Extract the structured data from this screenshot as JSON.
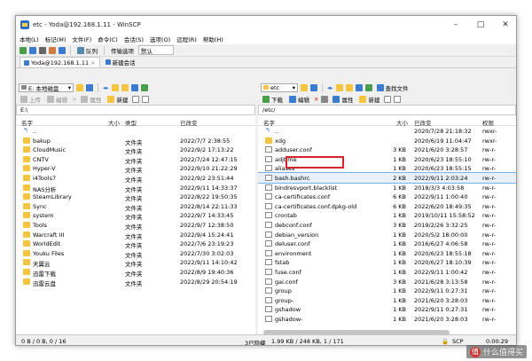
{
  "window": {
    "title": "etc - Yoda@192.168.1.11 - WinSCP"
  },
  "menu": [
    "本地(L)",
    "标记(M)",
    "文件(F)",
    "命令(C)",
    "会话(S)",
    "选项(O)",
    "远程(R)",
    "帮助(H)"
  ],
  "toolbar": {
    "sync_label": "队列",
    "transfer_label": "传输选项",
    "transfer_value": "默认"
  },
  "tabs": [
    "Yoda@192.168.1.11",
    "新建会话"
  ],
  "left": {
    "drive": "E: 本地磁盘",
    "upload": "上传",
    "edit": "编辑",
    "props": "属性",
    "new": "新建",
    "path": "E:\\",
    "headers": {
      "name": "名字",
      "size": "大小",
      "type": "类型",
      "modified": "已改变"
    },
    "rows": [
      {
        "name": "..",
        "size": "",
        "type": "",
        "modified": "",
        "kind": "up"
      },
      {
        "name": "bakup",
        "size": "",
        "type": "文件夹",
        "modified": "2022/7/7  2:38:55",
        "kind": "folder"
      },
      {
        "name": "CloudMusic",
        "size": "",
        "type": "文件夹",
        "modified": "2022/9/2  17:13:22",
        "kind": "folder"
      },
      {
        "name": "CNTV",
        "size": "",
        "type": "文件夹",
        "modified": "2022/7/24  12:47:15",
        "kind": "folder"
      },
      {
        "name": "Hyper-V",
        "size": "",
        "type": "文件夹",
        "modified": "2022/9/10  21:22:29",
        "kind": "folder"
      },
      {
        "name": "i4Tools7",
        "size": "",
        "type": "文件夹",
        "modified": "2022/9/2  23:51:44",
        "kind": "folder"
      },
      {
        "name": "NAS分析",
        "size": "",
        "type": "文件夹",
        "modified": "2022/9/11  14:33:37",
        "kind": "folder"
      },
      {
        "name": "SteamLibrary",
        "size": "",
        "type": "文件夹",
        "modified": "2022/8/22  19:50:35",
        "kind": "folder"
      },
      {
        "name": "Sync",
        "size": "",
        "type": "文件夹",
        "modified": "2022/8/14  22:11:33",
        "kind": "folder"
      },
      {
        "name": "system",
        "size": "",
        "type": "文件夹",
        "modified": "2022/9/7  14:33:45",
        "kind": "folder"
      },
      {
        "name": "Tools",
        "size": "",
        "type": "文件夹",
        "modified": "2022/9/7  12:38:50",
        "kind": "folder"
      },
      {
        "name": "Warcraft III",
        "size": "",
        "type": "文件夹",
        "modified": "2022/9/4  15:24:41",
        "kind": "folder"
      },
      {
        "name": "WorldEdit",
        "size": "",
        "type": "文件夹",
        "modified": "2022/7/6  23:19:23",
        "kind": "folder"
      },
      {
        "name": "Youku Files",
        "size": "",
        "type": "文件夹",
        "modified": "2022/7/30  3:02:03",
        "kind": "folder"
      },
      {
        "name": "天翼云",
        "size": "",
        "type": "文件夹",
        "modified": "2022/9/11  14:10:42",
        "kind": "folder"
      },
      {
        "name": "迅雷下载",
        "size": "",
        "type": "文件夹",
        "modified": "2022/8/9  19:40:36",
        "kind": "folder"
      },
      {
        "name": "迅雷云盘",
        "size": "",
        "type": "文件夹",
        "modified": "2022/8/29  20:54:19",
        "kind": "folder"
      }
    ],
    "status": "0 B / 0 B,  0 / 16"
  },
  "right": {
    "dir": "etc",
    "download": "下载",
    "edit": "编辑",
    "props": "属性",
    "new": "新建",
    "find": "查找文件",
    "path": "/etc/",
    "headers": {
      "name": "名字",
      "size": "大小",
      "modified": "已改变",
      "rights": "权限"
    },
    "rows": [
      {
        "name": "..",
        "size": "",
        "modified": "2020/7/28 21:18:32",
        "rights": "rwxr-",
        "kind": "up"
      },
      {
        "name": "xdg",
        "size": "",
        "modified": "2020/6/19 11:04:47",
        "rights": "rwxr-",
        "kind": "folder"
      },
      {
        "name": "adduser.conf",
        "size": "3 KB",
        "modified": "2021/6/20 3:28:57",
        "rights": "rw-r-",
        "kind": "file"
      },
      {
        "name": "adjtime",
        "size": "1 KB",
        "modified": "2020/6/23 18:55:10",
        "rights": "rw-r-",
        "kind": "file"
      },
      {
        "name": "aliases",
        "size": "1 KB",
        "modified": "2020/6/23 18:55:15",
        "rights": "rw-r-",
        "kind": "file"
      },
      {
        "name": "bash.bashrc",
        "size": "2 KB",
        "modified": "2022/9/11 2:03:24",
        "rights": "rw-r-",
        "kind": "file"
      },
      {
        "name": "bindresvport.blacklist",
        "size": "1 KB",
        "modified": "2018/3/3 4:03:58",
        "rights": "rw-r-",
        "kind": "file"
      },
      {
        "name": "ca-certificates.conf",
        "size": "6 KB",
        "modified": "2022/9/11 1:00:40",
        "rights": "rw-r-",
        "kind": "file"
      },
      {
        "name": "ca-certificates.conf.dpkg-old",
        "size": "6 KB",
        "modified": "2022/6/20 18:49:35",
        "rights": "rw-r-",
        "kind": "file"
      },
      {
        "name": "crontab",
        "size": "1 KB",
        "modified": "2019/10/11 15:58:52",
        "rights": "rw-r-",
        "kind": "file"
      },
      {
        "name": "debconf.conf",
        "size": "3 KB",
        "modified": "2019/2/26 3:32:25",
        "rights": "rw-r-",
        "kind": "file"
      },
      {
        "name": "debian_version",
        "size": "1 KB",
        "modified": "2020/5/2 18:00:00",
        "rights": "rw-r-",
        "kind": "file"
      },
      {
        "name": "deluser.conf",
        "size": "1 KB",
        "modified": "2016/6/27 4:06:58",
        "rights": "rw-r-",
        "kind": "file"
      },
      {
        "name": "environment",
        "size": "1 KB",
        "modified": "2020/6/23 18:55:18",
        "rights": "rw-r-",
        "kind": "file"
      },
      {
        "name": "fstab",
        "size": "1 KB",
        "modified": "2020/6/27 18:10:39",
        "rights": "rw-r-",
        "kind": "file"
      },
      {
        "name": "fuse.conf",
        "size": "1 KB",
        "modified": "2022/9/11 1:00:42",
        "rights": "rw-r-",
        "kind": "file"
      },
      {
        "name": "gai.conf",
        "size": "3 KB",
        "modified": "2021/6/28 3:13:58",
        "rights": "rw-r-",
        "kind": "file"
      },
      {
        "name": "group",
        "size": "1 KB",
        "modified": "2022/9/11 0:27:31",
        "rights": "rw-r-",
        "kind": "file"
      },
      {
        "name": "group-",
        "size": "1 KB",
        "modified": "2021/6/20 3:28:03",
        "rights": "rw-r-",
        "kind": "file"
      },
      {
        "name": "gshadow",
        "size": "1 KB",
        "modified": "2022/9/11 0:27:31",
        "rights": "rw-r-",
        "kind": "file"
      },
      {
        "name": "gshadow-",
        "size": "1 KB",
        "modified": "2021/6/20 3:28:03",
        "rights": "rw-r-",
        "kind": "file"
      }
    ],
    "status": "1.99 KB / 248 KB,  1 / 171",
    "hidden": "3已隐藏"
  },
  "statusbar": {
    "protocol": "SCP",
    "time": "0:00:29"
  },
  "watermark": "什么值得买",
  "colors": {
    "folder": "#f5c542",
    "highlight": "#d4232a"
  }
}
